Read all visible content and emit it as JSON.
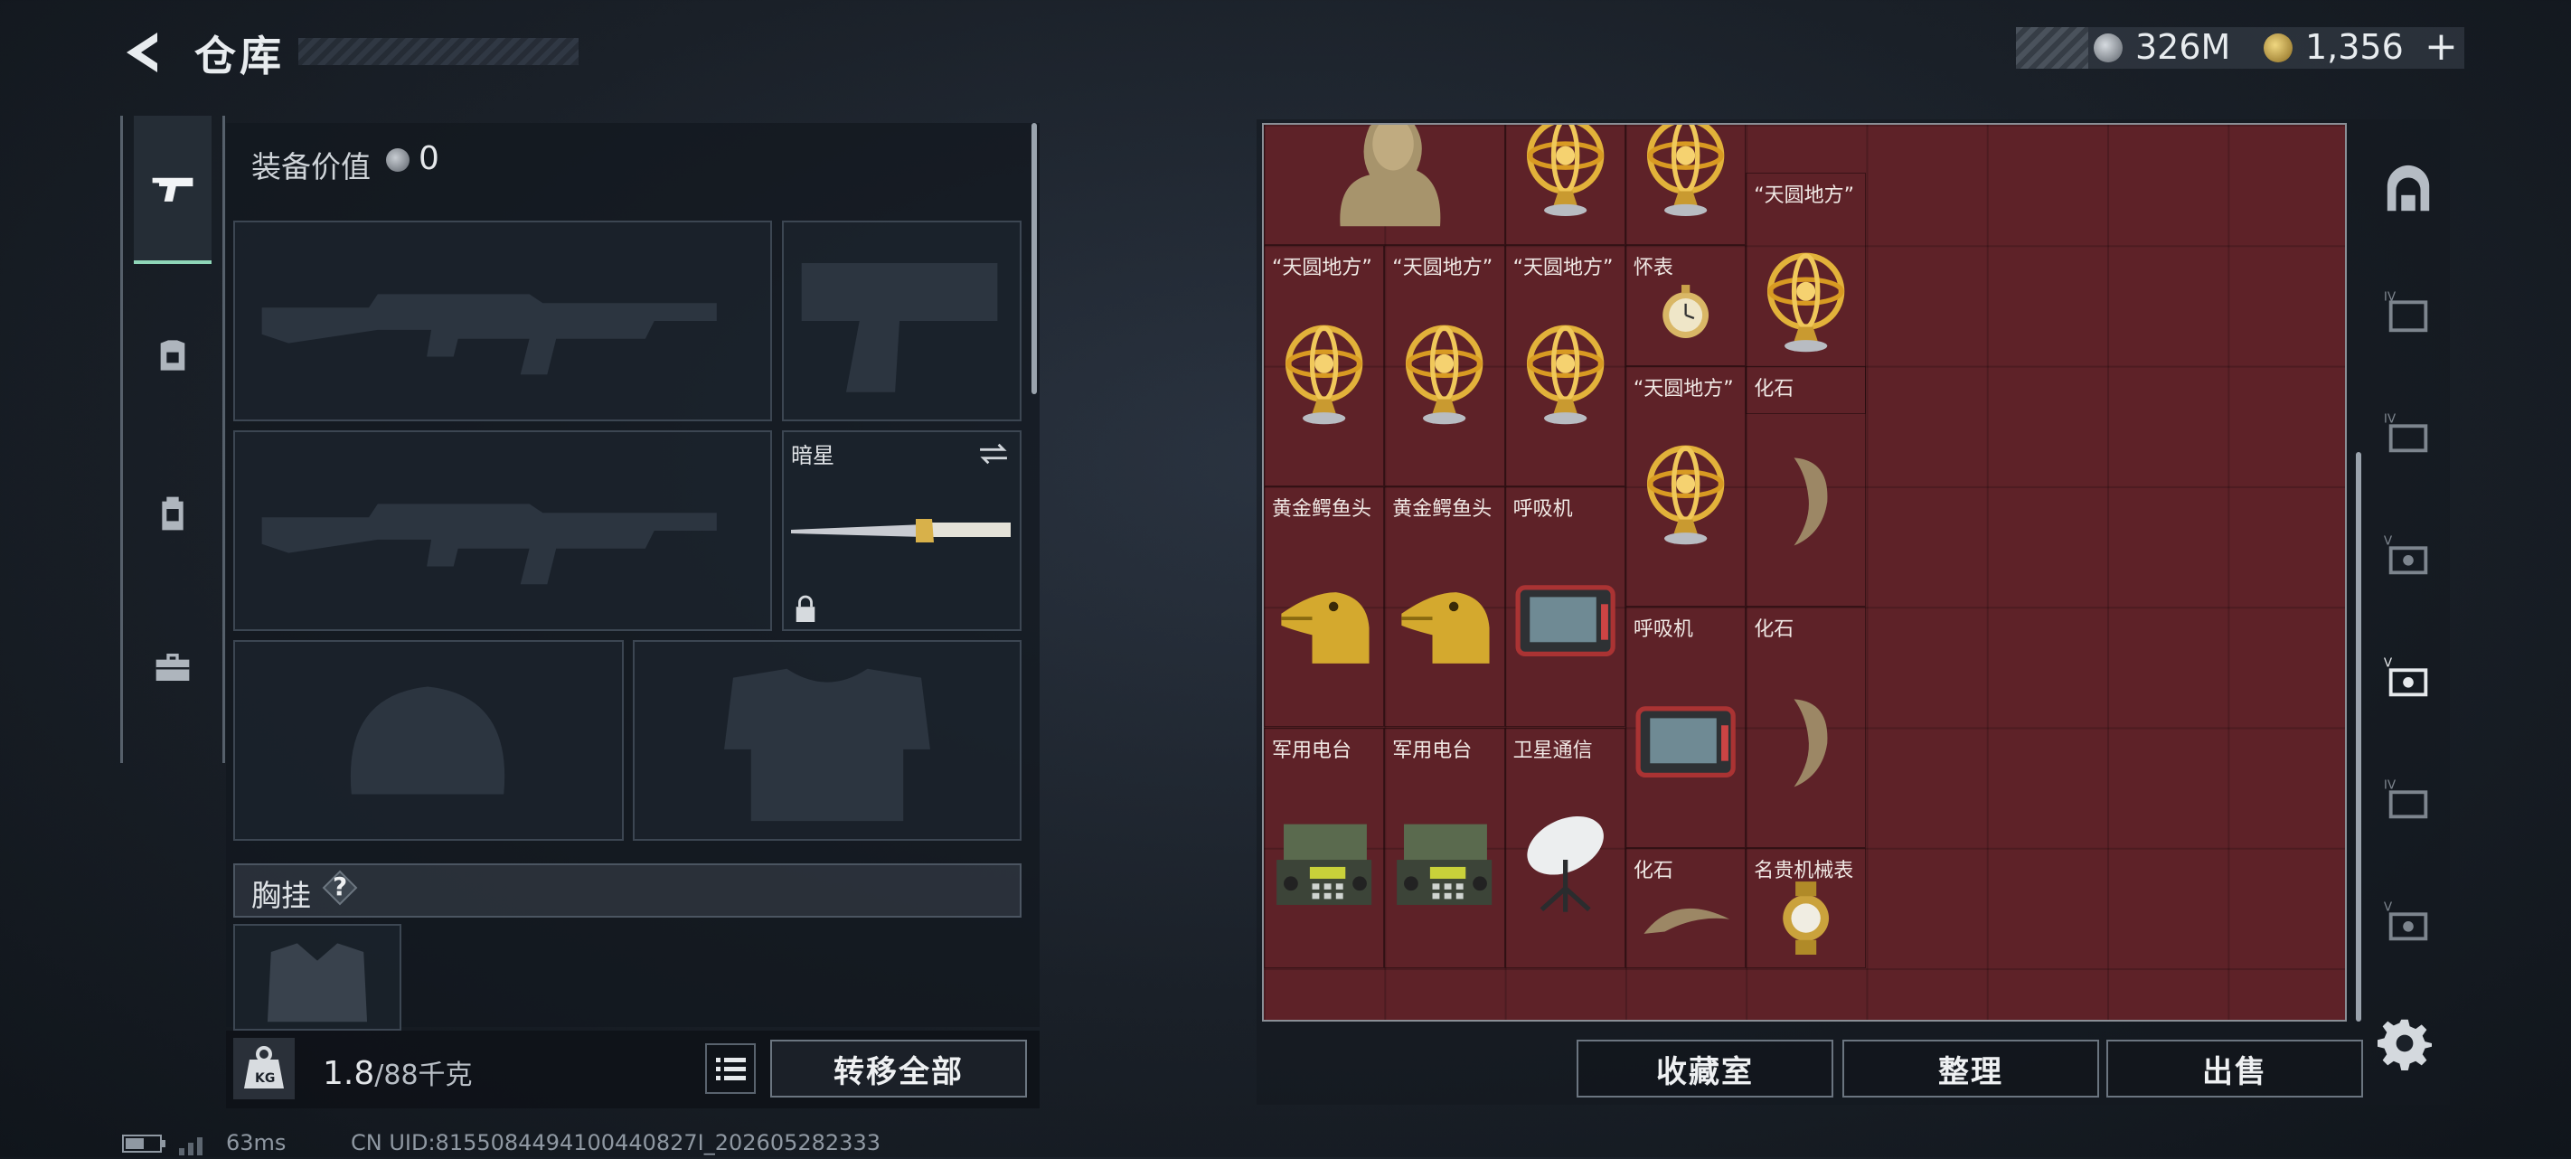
{
  "header": {
    "title": "仓库",
    "currency_silver": "326M",
    "currency_gold": "1,356",
    "add_symbol": "+"
  },
  "equipment": {
    "value_label": "装备价值",
    "value": "0",
    "knife_name": "暗星",
    "chest_label": "胸挂",
    "help_symbol": "?",
    "weight_current": "1.8",
    "weight_max": "/88千克",
    "transfer_all": "转移全部"
  },
  "status": {
    "ping": "63ms",
    "uid": "CN UID:8155084494100440827I_202605282333"
  },
  "stash": {
    "items": [
      {
        "name": "",
        "kind": "bust"
      },
      {
        "name": "",
        "kind": "armillary"
      },
      {
        "name": "",
        "kind": "armillary"
      },
      {
        "name": "“天圆地方”",
        "kind": "armillary"
      },
      {
        "name": "“天圆地方”",
        "kind": "armillary"
      },
      {
        "name": "“天圆地方”",
        "kind": "armillary"
      },
      {
        "name": "“天圆地方”",
        "kind": "armillary"
      },
      {
        "name": "怀表",
        "kind": "pocketwatch"
      },
      {
        "name": "“天圆地方”",
        "kind": "armillary"
      },
      {
        "name": "化石",
        "kind": "claw"
      },
      {
        "name": "黄金鳄鱼头",
        "kind": "croc"
      },
      {
        "name": "黄金鳄鱼头",
        "kind": "croc"
      },
      {
        "name": "呼吸机",
        "kind": "ventilator"
      },
      {
        "name": "呼吸机",
        "kind": "ventilator"
      },
      {
        "name": "化石",
        "kind": "claw"
      },
      {
        "name": "军用电台",
        "kind": "radio"
      },
      {
        "name": "军用电台",
        "kind": "radio"
      },
      {
        "name": "卫星通信",
        "kind": "satellite"
      },
      {
        "name": "化石",
        "kind": "claw-flat"
      },
      {
        "name": "名贵机械表",
        "kind": "watch"
      }
    ],
    "buttons": {
      "collection": "收藏室",
      "organize": "整理",
      "sell": "出售"
    }
  },
  "colors": {
    "stash_bg": "#5e2228",
    "accent": "#8fd6b8",
    "panel": "#12171e"
  }
}
